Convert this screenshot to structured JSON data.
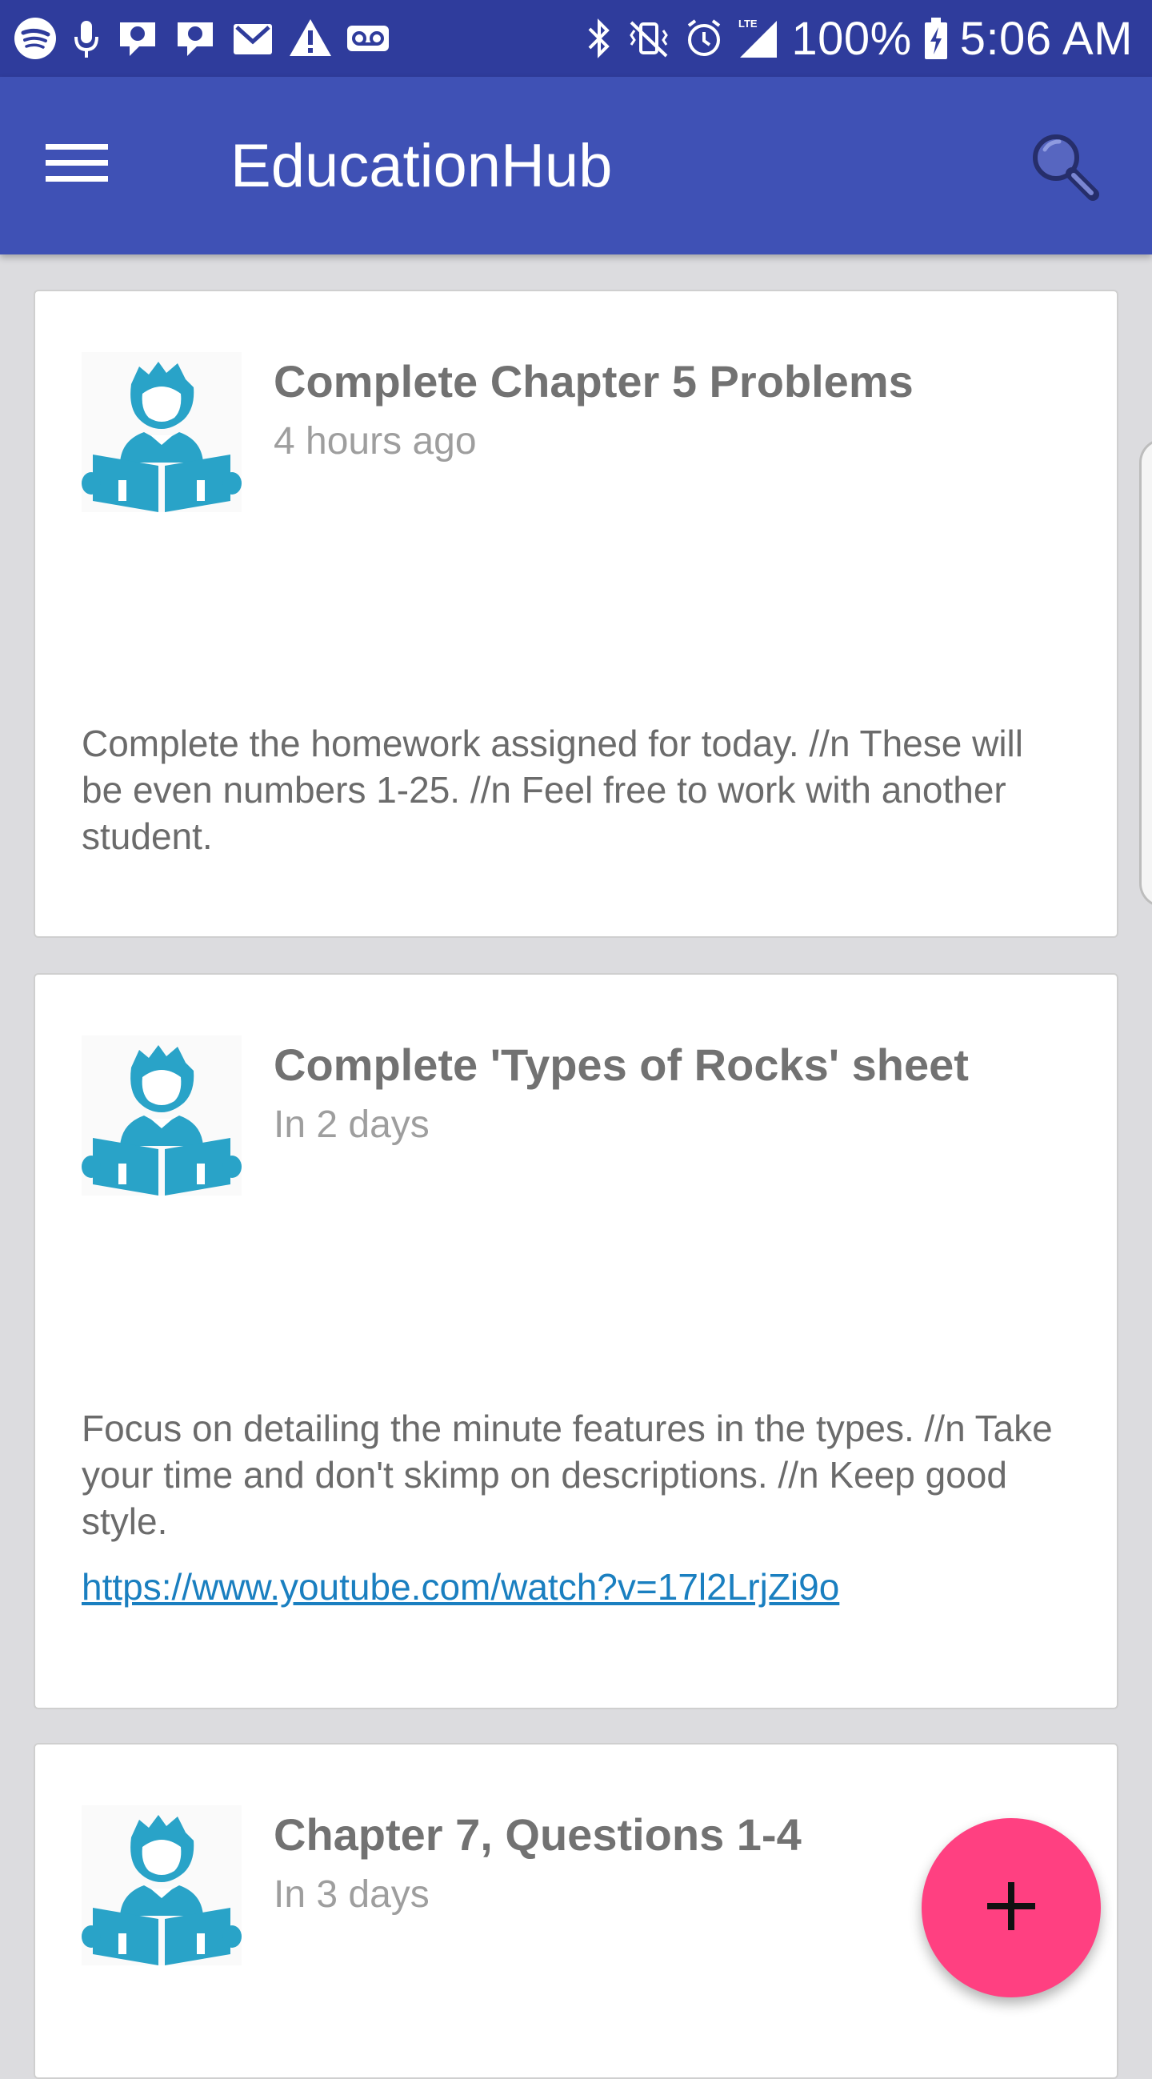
{
  "status_bar": {
    "battery": "100%",
    "time": "5:06 AM"
  },
  "app_bar": {
    "title": "EducationHub"
  },
  "assignments": [
    {
      "title": "Complete Chapter 5 Problems",
      "time": "4 hours ago",
      "description": "Complete the homework assigned for today. //n These will be even numbers 1-25. //n Feel free to work with another student."
    },
    {
      "title": "Complete 'Types of Rocks' sheet",
      "time": "In 2 days",
      "description": "Focus on detailing the minute features in the types. //n Take your time and don't skimp on descriptions. //n Keep good style.",
      "link": "https://www.youtube.com/watch?v=17l2LrjZi9o"
    },
    {
      "title": "Chapter 7, Questions 1-4",
      "time": "In 3 days"
    }
  ],
  "colors": {
    "status_bar": "#2f3c9c",
    "app_bar": "#3f51b5",
    "fab": "#ff4081",
    "avatar_icon": "#29a3c8",
    "link": "#1a7fc0"
  }
}
